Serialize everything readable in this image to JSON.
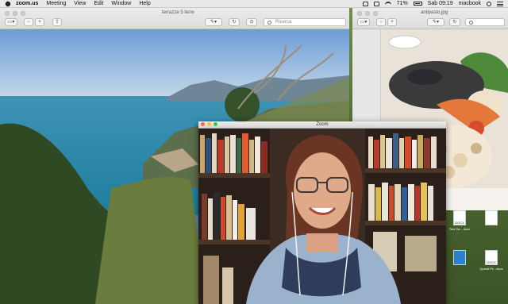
{
  "menubar": {
    "app_name": "zoom.us",
    "items": [
      "Meeting",
      "View",
      "Edit",
      "Window",
      "Help"
    ],
    "battery": "71%",
    "clock": "Sab 09:19",
    "user": "macbook"
  },
  "preview1": {
    "title": "terrazze 5 terre",
    "search_placeholder": "Ricerca"
  },
  "preview2": {
    "title": "antipasto.jpg"
  },
  "zoom": {
    "title": "Zoom"
  },
  "desktop_icons": [
    {
      "label": "DOCX",
      "sublabel": "Tesi Ga... docx"
    },
    {
      "label": "DOCX",
      "sublabel": "Questi Pe...docx"
    },
    {
      "label": "",
      "sublabel": ""
    }
  ],
  "colors": {
    "menubar_bg": "#e9e9ea",
    "close": "#fc605b",
    "minimize": "#fdbc40",
    "zoom_btn": "#34c84a",
    "sea": "#2e8fae"
  }
}
